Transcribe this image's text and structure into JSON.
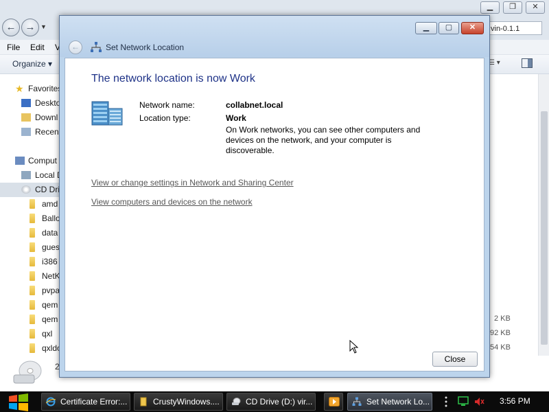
{
  "explorer": {
    "address_crumb": "vin-0.1.1",
    "menu": [
      "File",
      "Edit",
      "V"
    ],
    "toolbar": {
      "organize": "Organize"
    },
    "nav": {
      "favorites": "Favorites",
      "desktop": "Deskto",
      "downloads": "Downl",
      "recent": "Recent",
      "computer": "Comput",
      "local_disk": "Local D",
      "cd_drive": "CD Dri",
      "folders": [
        "amd",
        "Ballo",
        "data",
        "gues",
        "i386",
        "NetK",
        "pvpa",
        "qem",
        "qem",
        "qxl",
        "qxldo"
      ]
    },
    "sizes": [
      "2 KB",
      "92 KB",
      "54 KB"
    ],
    "bottom_count": "2"
  },
  "dialog": {
    "title": "Set Network Location",
    "heading": "The network location is now Work",
    "network_name_label": "Network name:",
    "network_name_value": "collabnet.local",
    "location_type_label": "Location type:",
    "location_type_value": "Work",
    "description": "On Work networks, you can see other computers and devices on the network, and your computer is discoverable.",
    "link_settings": "View or change settings in Network and Sharing Center",
    "link_computers": "View computers and devices on the network",
    "close_button": "Close"
  },
  "taskbar": {
    "items": [
      {
        "label": "Certificate Error:...",
        "icon": "ie-icon"
      },
      {
        "label": "CrustyWindows....",
        "icon": "folder-icon"
      },
      {
        "label": "CD Drive (D:) vir...",
        "icon": "cd-drive-icon"
      },
      {
        "label": "Set Network Lo...",
        "icon": "network-icon"
      }
    ],
    "clock": "3:56 PM"
  },
  "colors": {
    "dialog_frame": "#bcd4ec",
    "heading_blue": "#1e3287",
    "taskbar": "#0b0b0b"
  }
}
